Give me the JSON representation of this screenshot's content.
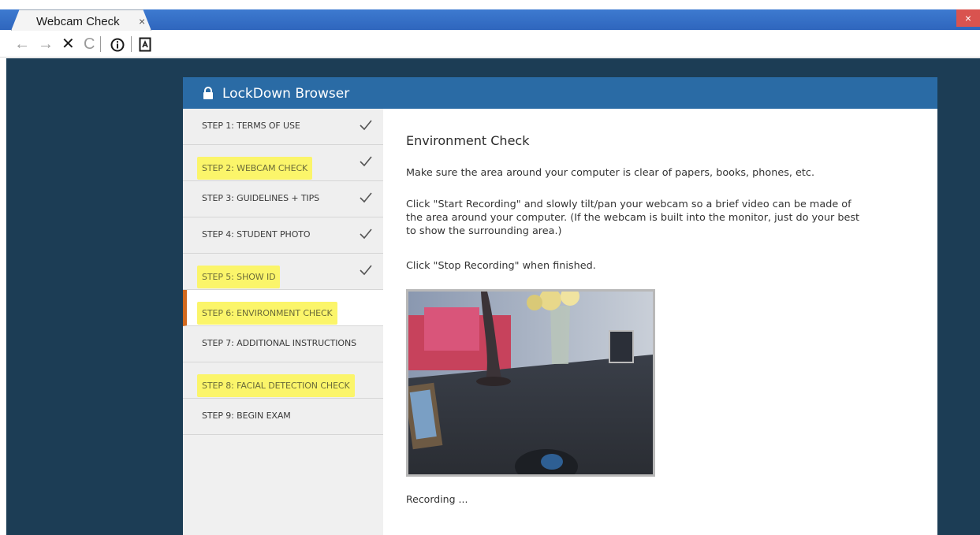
{
  "browser": {
    "tab_title": "Webcam Check",
    "tab_close": "×",
    "window_close": "×",
    "toolbar_icons": [
      "back-arrow-icon",
      "forward-arrow-icon",
      "stop-icon",
      "reload-icon",
      "info-icon",
      "document-icon"
    ]
  },
  "app": {
    "title": "LockDown Browser",
    "accent_color": "#2a6ba5",
    "active_marker_color": "#d2691e",
    "highlight_color": "#fbf56a"
  },
  "steps": [
    {
      "label": "STEP 1: TERMS OF USE",
      "completed": true,
      "highlighted": false,
      "active": false
    },
    {
      "label": "STEP 2: WEBCAM CHECK",
      "completed": true,
      "highlighted": true,
      "active": false
    },
    {
      "label": "STEP 3: GUIDELINES + TIPS",
      "completed": true,
      "highlighted": false,
      "active": false
    },
    {
      "label": "STEP 4: STUDENT PHOTO",
      "completed": true,
      "highlighted": false,
      "active": false
    },
    {
      "label": "STEP 5: SHOW ID",
      "completed": true,
      "highlighted": true,
      "active": false
    },
    {
      "label": "STEP 6: ENVIRONMENT CHECK",
      "completed": false,
      "highlighted": true,
      "active": true
    },
    {
      "label": "STEP 7: ADDITIONAL INSTRUCTIONS",
      "completed": false,
      "highlighted": false,
      "active": false
    },
    {
      "label": "STEP 8: FACIAL DETECTION CHECK",
      "completed": false,
      "highlighted": true,
      "active": false
    },
    {
      "label": "STEP 9: BEGIN EXAM",
      "completed": false,
      "highlighted": false,
      "active": false
    }
  ],
  "content": {
    "heading": "Environment Check",
    "para1": "Make sure the area around your computer is clear of papers, books, phones, etc.",
    "para2": "Click \"Start Recording\" and slowly tilt/pan your webcam so a brief video can be made of the area around your computer. (If the webcam is built into the monitor, just do your best to show the surrounding area.)",
    "para3": "Click \"Stop Recording\" when finished.",
    "status": "Recording ..."
  }
}
